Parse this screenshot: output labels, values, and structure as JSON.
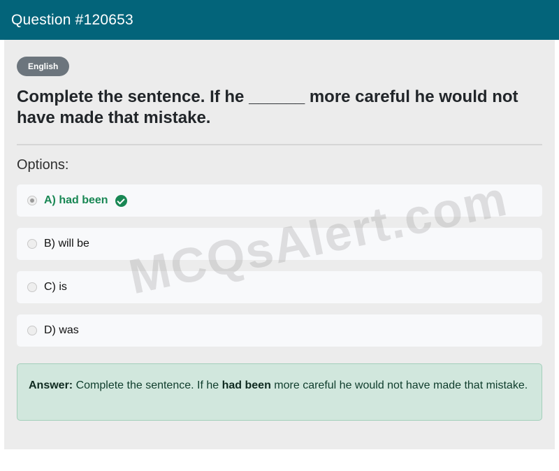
{
  "header": {
    "title": "Question #120653"
  },
  "badge": {
    "label": "English"
  },
  "question": {
    "text": "Complete the sentence. If he ______ more careful he would not have made that mistake."
  },
  "options": {
    "label": "Options:",
    "items": [
      {
        "label": "A) had been",
        "selected": true,
        "correct": true
      },
      {
        "label": "B) will be",
        "selected": false,
        "correct": false
      },
      {
        "label": "C) is",
        "selected": false,
        "correct": false
      },
      {
        "label": "D) was",
        "selected": false,
        "correct": false
      }
    ]
  },
  "answer": {
    "prefix": "Answer:",
    "before": "Complete the sentence. If he",
    "highlight": "had been",
    "after": "more careful he would not have made that mistake."
  },
  "watermark": {
    "text": "MCQsAlert.com"
  },
  "colors": {
    "header_bg": "#03647a",
    "correct": "#198754",
    "answer_bg": "#d1e7dd",
    "badge_bg": "#6c757d"
  },
  "icons": {
    "correct_indicator": "check-circle-icon"
  }
}
